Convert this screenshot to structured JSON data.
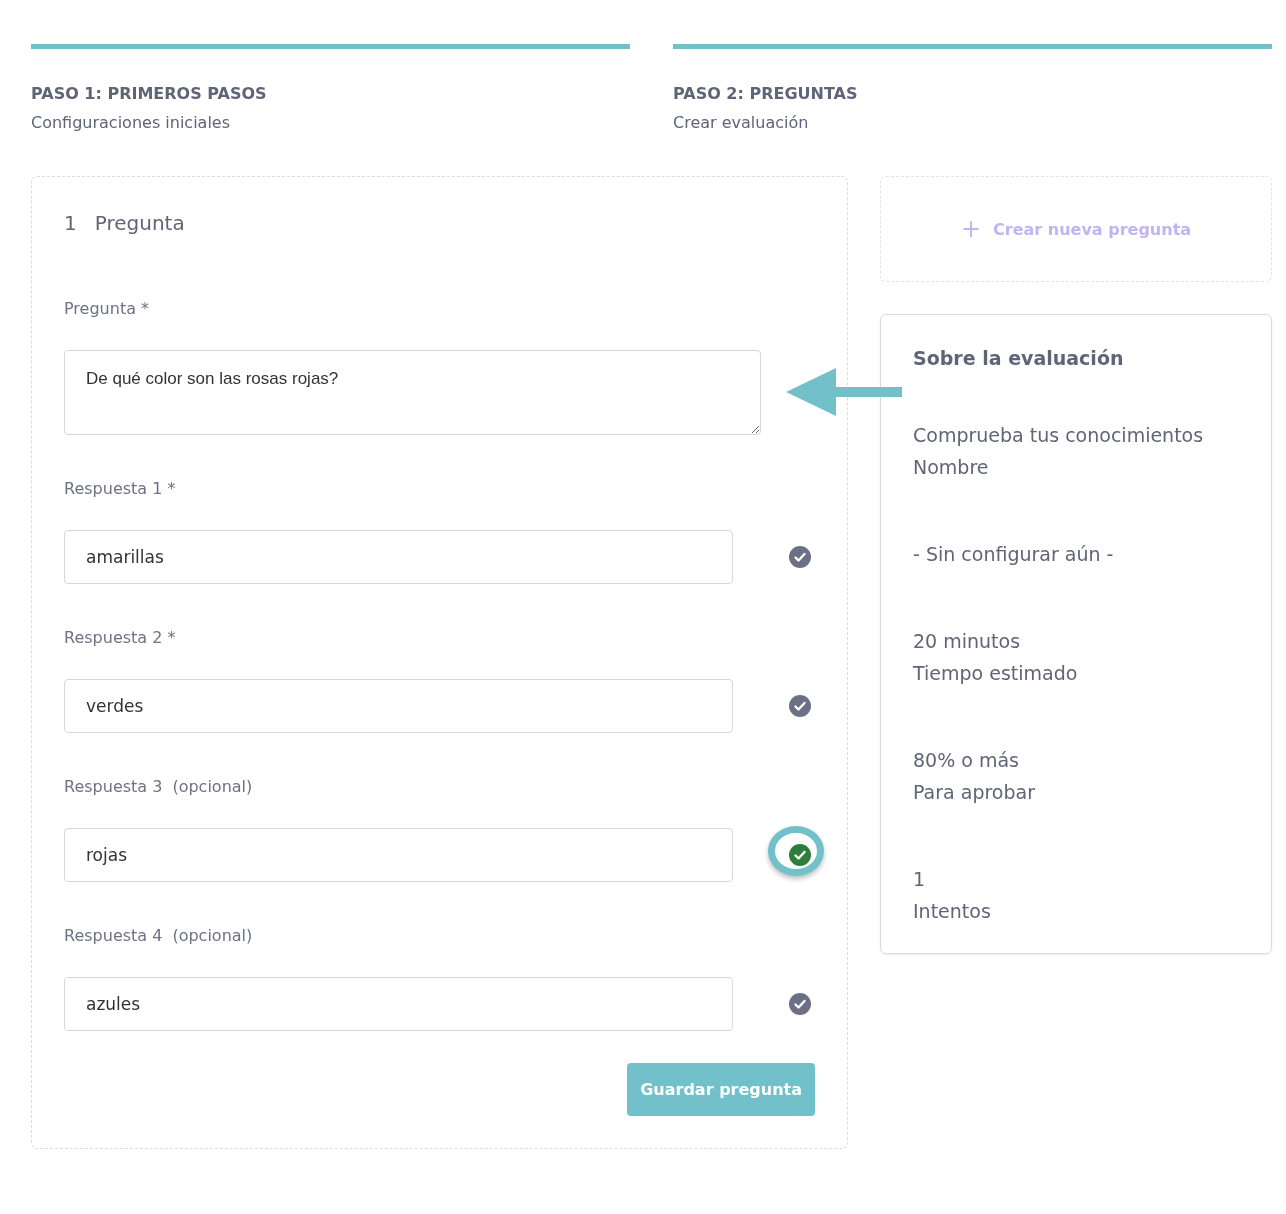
{
  "steps": [
    {
      "title": "PASO 1: PRIMEROS PASOS",
      "subtitle": "Configuraciones iniciales",
      "active": true
    },
    {
      "title": "PASO 2: PREGUNTAS",
      "subtitle": "Crear evaluación",
      "active": true
    }
  ],
  "question_card": {
    "number": "1",
    "heading": "Pregunta",
    "question_label": "Pregunta *",
    "question_value": "De qué color son las rosas rojas?",
    "answers": [
      {
        "label": "Respuesta 1 *",
        "value": "amarillas",
        "selected": false
      },
      {
        "label": "Respuesta 2 *",
        "value": "verdes",
        "selected": false
      },
      {
        "label": "Respuesta 3",
        "note": "(opcional)",
        "value": "rojas",
        "selected": true
      },
      {
        "label": "Respuesta 4",
        "note": "(opcional)",
        "value": "azules",
        "selected": false
      }
    ],
    "save_button": "Guardar pregunta"
  },
  "new_question": {
    "icon": "+",
    "label": "Crear nueva pregunta"
  },
  "summary": {
    "title": "Sobre la evaluación",
    "items": [
      {
        "lines": [
          "Comprueba tus conocimientos",
          "Nombre"
        ]
      },
      {
        "lines": [
          "- Sin configurar aún -"
        ]
      },
      {
        "lines": [
          "20 minutos",
          "Tiempo estimado"
        ]
      },
      {
        "lines": [
          "80% o más",
          "Para aprobar"
        ]
      },
      {
        "lines": [
          "1",
          "Intentos"
        ]
      }
    ]
  }
}
